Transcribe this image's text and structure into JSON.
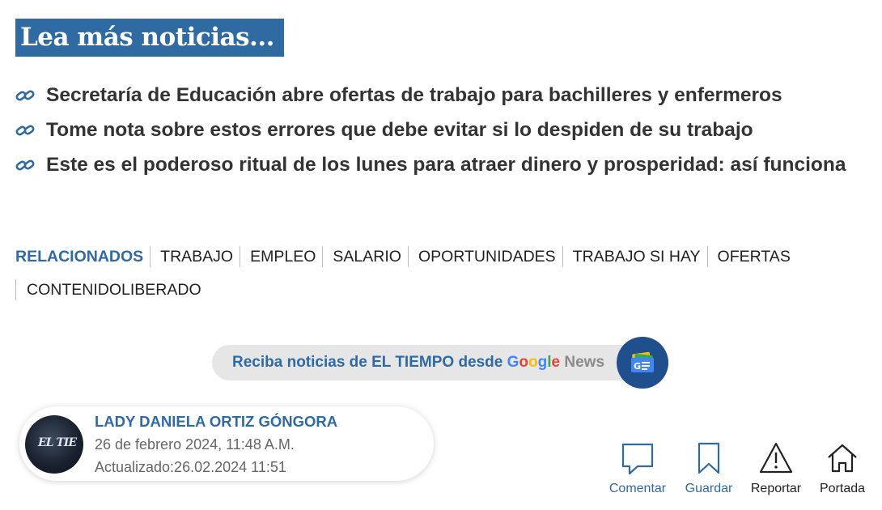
{
  "section_heading": "Lea más noticias...",
  "related_links": [
    "Secretaría de Educación abre ofertas de trabajo para bachilleres y enfermeros",
    "Tome nota sobre estos errores que debe evitar si lo despiden de su trabajo",
    "Este es el poderoso ritual de los lunes para atraer dinero y prosperidad: así funciona"
  ],
  "tags": {
    "label": "RELACIONADOS",
    "items": [
      "TRABAJO",
      "EMPLEO",
      "SALARIO",
      "OPORTUNIDADES",
      "TRABAJO SI HAY",
      "OFERTAS",
      "CONTENIDOLIBERADO"
    ]
  },
  "google_news": {
    "text": "Reciba noticias de EL TIEMPO desde",
    "google_letters": [
      "G",
      "o",
      "o",
      "g",
      "l",
      "e"
    ],
    "news": "News",
    "badge_icon": "google-news-icon"
  },
  "author": {
    "name": "LADY DANIELA ORTIZ GÓNGORA",
    "date": "26 de febrero 2024, 11:48 A.M.",
    "updated": "Actualizado:26.02.2024 11:51",
    "avatar_text": "EL TIE"
  },
  "actions": [
    {
      "label": "Comentar",
      "icon": "comment-icon"
    },
    {
      "label": "Guardar",
      "icon": "bookmark-icon"
    },
    {
      "label": "Reportar",
      "icon": "warning-icon"
    },
    {
      "label": "Portada",
      "icon": "home-icon"
    }
  ],
  "colors": {
    "accent": "#2f6aa3",
    "badge": "#1f4f8c",
    "pill": "#e6e6e6"
  }
}
